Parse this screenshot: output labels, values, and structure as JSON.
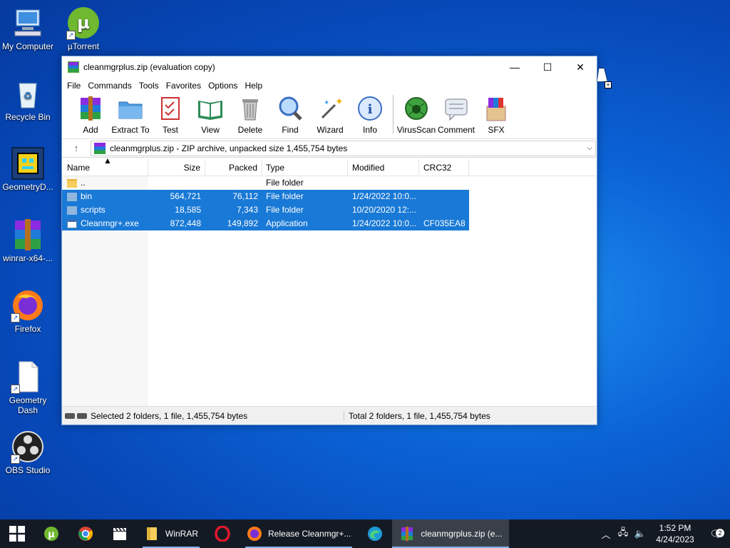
{
  "desktop": {
    "icons": [
      {
        "label": "My Computer"
      },
      {
        "label": "µTorrent"
      },
      {
        "label": "Recycle Bin"
      },
      {
        "label": "GeometryD..."
      },
      {
        "label": "winrar-x64-..."
      },
      {
        "label": "Firefox"
      },
      {
        "label": "Geometry Dash"
      },
      {
        "label": "OBS Studio"
      }
    ]
  },
  "window": {
    "title": "cleanmgrplus.zip (evaluation copy)",
    "menu": [
      "File",
      "Commands",
      "Tools",
      "Favorites",
      "Options",
      "Help"
    ],
    "toolbar": [
      "Add",
      "Extract To",
      "Test",
      "View",
      "Delete",
      "Find",
      "Wizard",
      "Info",
      "VirusScan",
      "Comment",
      "SFX"
    ],
    "address": "cleanmgrplus.zip - ZIP archive, unpacked size 1,455,754 bytes",
    "columns": {
      "name": "Name",
      "size": "Size",
      "packed": "Packed",
      "type": "Type",
      "modified": "Modified",
      "crc": "CRC32"
    },
    "rows": [
      {
        "name": "..",
        "size": "",
        "packed": "",
        "type": "File folder",
        "modified": "",
        "crc": ""
      },
      {
        "name": "bin",
        "size": "564,721",
        "packed": "76,112",
        "type": "File folder",
        "modified": "1/24/2022 10:0...",
        "crc": ""
      },
      {
        "name": "scripts",
        "size": "18,585",
        "packed": "7,343",
        "type": "File folder",
        "modified": "10/20/2020 12:...",
        "crc": ""
      },
      {
        "name": "Cleanmgr+.exe",
        "size": "872,448",
        "packed": "149,892",
        "type": "Application",
        "modified": "1/24/2022 10:0...",
        "crc": "CF035EA8"
      }
    ],
    "status_selected": "Selected 2 folders, 1 file, 1,455,754 bytes",
    "status_total": "Total 2 folders, 1 file, 1,455,754 bytes"
  },
  "taskbar": {
    "winrar_label": "WinRAR",
    "firefox_label": "Release Cleanmgr+...",
    "active_label": "cleanmgrplus.zip (e...",
    "time": "1:52 PM",
    "date": "4/24/2023",
    "notification_count": "2"
  }
}
